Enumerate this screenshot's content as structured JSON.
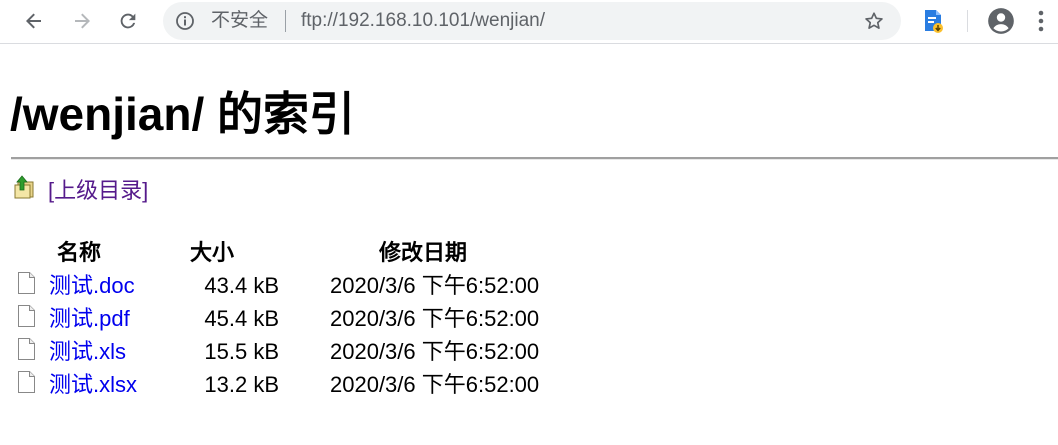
{
  "browser": {
    "security_label": "不安全",
    "url": "ftp://192.168.10.101/wenjian/",
    "icons": {
      "back": "back-arrow-icon",
      "forward": "forward-arrow-icon",
      "reload": "reload-icon",
      "info": "info-icon",
      "bookmark": "star-icon",
      "extension": "document-download-extension-icon",
      "profile": "account-circle-icon",
      "menu": "vertical-dots-icon"
    }
  },
  "page": {
    "title": "/wenjian/ 的索引",
    "parent_link": "[上级目录]",
    "columns": {
      "name": "名称",
      "size": "大小",
      "modified": "修改日期"
    },
    "files": [
      {
        "name": "测试.doc",
        "size": "43.4 kB",
        "modified": "2020/3/6 下午6:52:00"
      },
      {
        "name": "测试.pdf",
        "size": "45.4 kB",
        "modified": "2020/3/6 下午6:52:00"
      },
      {
        "name": "测试.xls",
        "size": "15.5 kB",
        "modified": "2020/3/6 下午6:52:00"
      },
      {
        "name": "测试.xlsx",
        "size": "13.2 kB",
        "modified": "2020/3/6 下午6:52:00"
      }
    ]
  },
  "colors": {
    "link": "#0000ee",
    "visited_link": "#551a8b",
    "omnibox_bg": "#f1f3f4",
    "toolbar_icon": "#5f6368"
  }
}
